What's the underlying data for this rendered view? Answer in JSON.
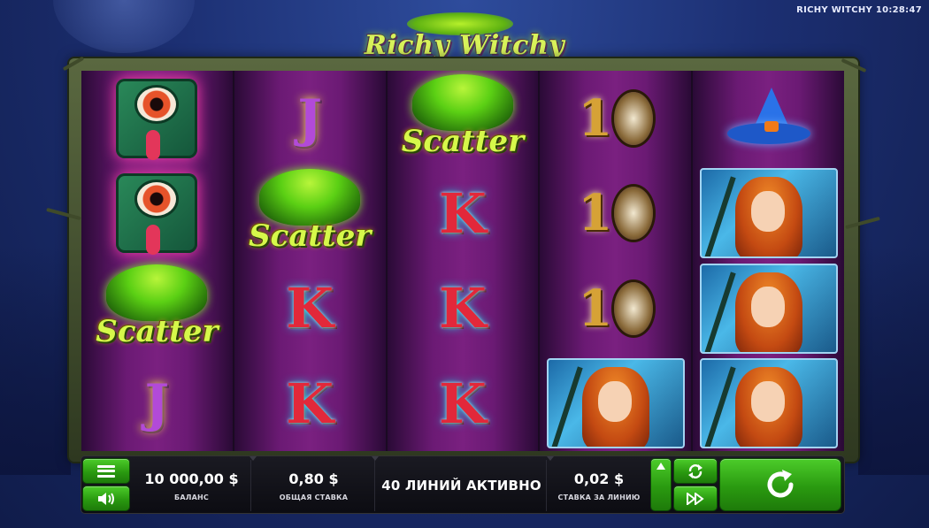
{
  "status_bar": {
    "text": "RICHY WITCHY 10:28:47"
  },
  "logo": {
    "text": "Richy Witchy"
  },
  "reels": [
    [
      "eye-book",
      "eye-book",
      "scatter",
      "j"
    ],
    [
      "j",
      "scatter",
      "k",
      "k"
    ],
    [
      "scatter",
      "k",
      "k",
      "k"
    ],
    [
      "ten",
      "ten",
      "ten",
      "witch"
    ],
    [
      "hat",
      "witch",
      "witch",
      "witch"
    ]
  ],
  "symbols": {
    "scatter_label": "Scatter",
    "k_label": "K",
    "j_label": "J",
    "ten_label": "1"
  },
  "panel": {
    "balance_value": "10 000,00 $",
    "balance_label": "БАЛАНС",
    "total_bet_value": "0,80 $",
    "total_bet_label": "ОБЩАЯ СТАВКА",
    "lines_text": "40 ЛИНИЙ АКТИВНО",
    "line_bet_value": "0,02 $",
    "line_bet_label": "СТАВКА ЗА ЛИНИЮ"
  },
  "icons": {
    "menu": "menu-icon",
    "sound": "speaker-icon",
    "up": "arrow-up-icon",
    "autoplay": "autoplay-icon",
    "fast": "fast-forward-icon",
    "spin": "spin-icon"
  },
  "colors": {
    "accent_green": "#2a9a10",
    "reel_purple": "#7a2080",
    "k_red": "#e2283a"
  }
}
